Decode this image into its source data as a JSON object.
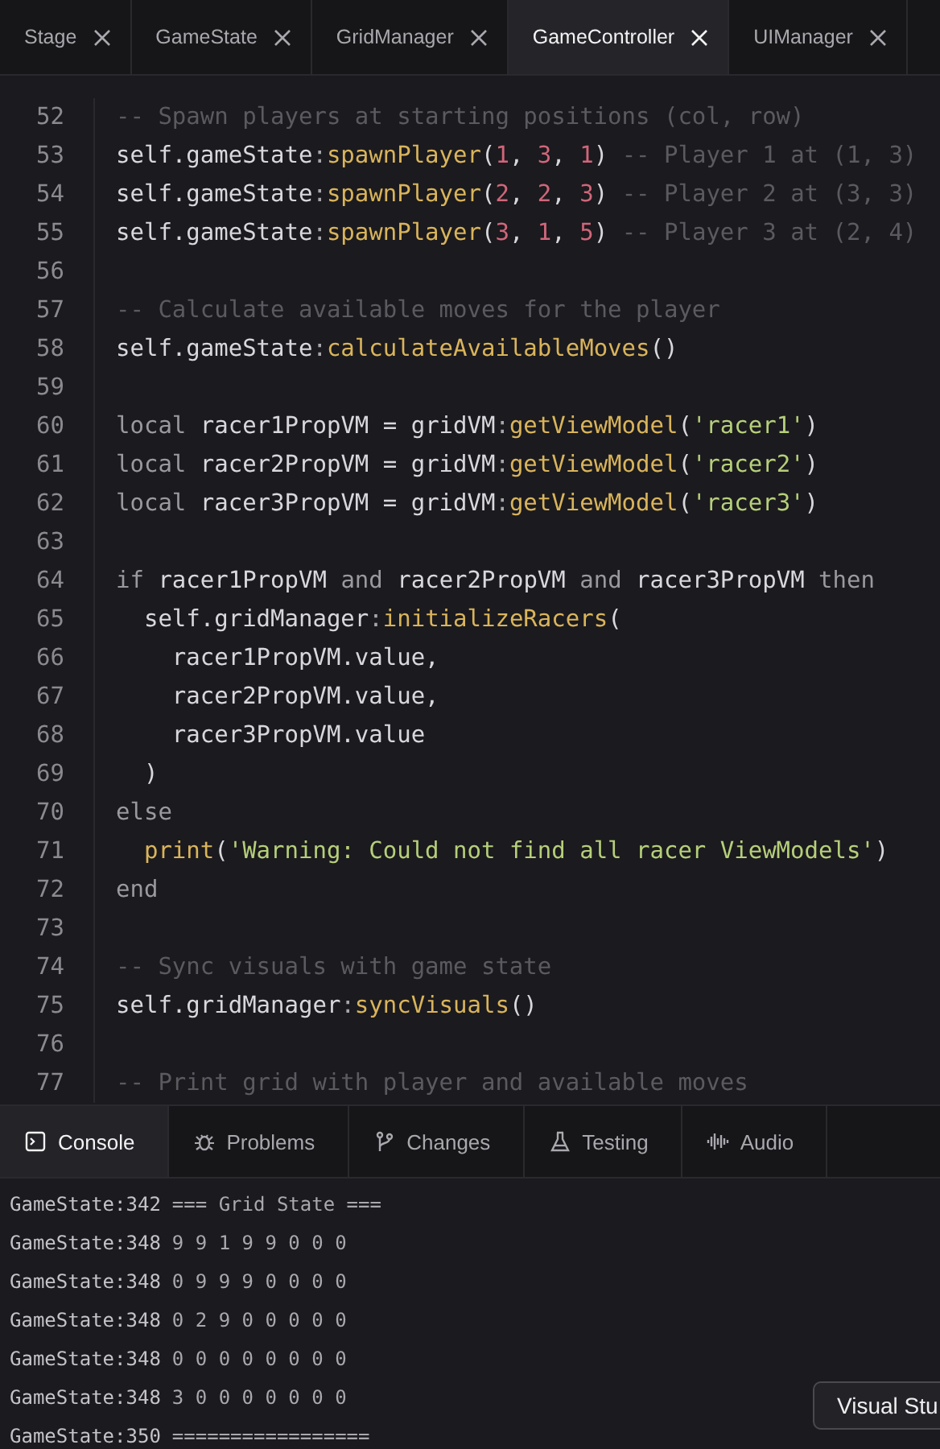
{
  "editor_tabs": [
    {
      "label": "Stage",
      "selected": false
    },
    {
      "label": "GameState",
      "selected": false
    },
    {
      "label": "GridManager",
      "selected": false
    },
    {
      "label": "GameController",
      "selected": true
    },
    {
      "label": "UIManager",
      "selected": false
    }
  ],
  "code_lines": [
    {
      "n": "52",
      "tokens": [
        {
          "text": "-- Spawn players at starting positions (col, row)",
          "kind": "comment"
        }
      ]
    },
    {
      "n": "53",
      "tokens": [
        {
          "text": "self.gameState",
          "kind": "plain"
        },
        {
          "text": ":",
          "kind": "punct"
        },
        {
          "text": "spawnPlayer",
          "kind": "fn"
        },
        {
          "text": "(",
          "kind": "plain"
        },
        {
          "text": "1",
          "kind": "num"
        },
        {
          "text": ", ",
          "kind": "plain"
        },
        {
          "text": "3",
          "kind": "num"
        },
        {
          "text": ", ",
          "kind": "plain"
        },
        {
          "text": "1",
          "kind": "num"
        },
        {
          "text": ")",
          "kind": "plain"
        },
        {
          "text": " -- Player 1 at (1, 3)",
          "kind": "comment"
        }
      ]
    },
    {
      "n": "54",
      "tokens": [
        {
          "text": "self.gameState",
          "kind": "plain"
        },
        {
          "text": ":",
          "kind": "punct"
        },
        {
          "text": "spawnPlayer",
          "kind": "fn"
        },
        {
          "text": "(",
          "kind": "plain"
        },
        {
          "text": "2",
          "kind": "num"
        },
        {
          "text": ", ",
          "kind": "plain"
        },
        {
          "text": "2",
          "kind": "num"
        },
        {
          "text": ", ",
          "kind": "plain"
        },
        {
          "text": "3",
          "kind": "num"
        },
        {
          "text": ")",
          "kind": "plain"
        },
        {
          "text": " -- Player 2 at (3, 3)",
          "kind": "comment"
        }
      ]
    },
    {
      "n": "55",
      "tokens": [
        {
          "text": "self.gameState",
          "kind": "plain"
        },
        {
          "text": ":",
          "kind": "punct"
        },
        {
          "text": "spawnPlayer",
          "kind": "fn"
        },
        {
          "text": "(",
          "kind": "plain"
        },
        {
          "text": "3",
          "kind": "num"
        },
        {
          "text": ", ",
          "kind": "plain"
        },
        {
          "text": "1",
          "kind": "num"
        },
        {
          "text": ", ",
          "kind": "plain"
        },
        {
          "text": "5",
          "kind": "num"
        },
        {
          "text": ")",
          "kind": "plain"
        },
        {
          "text": " -- Player 3 at (2, 4)",
          "kind": "comment"
        }
      ]
    },
    {
      "n": "56"
    },
    {
      "n": "57",
      "tokens": [
        {
          "text": "-- Calculate available moves for the player",
          "kind": "comment"
        }
      ]
    },
    {
      "n": "58",
      "tokens": [
        {
          "text": "self.gameState",
          "kind": "plain"
        },
        {
          "text": ":",
          "kind": "punct"
        },
        {
          "text": "calculateAvailableMoves",
          "kind": "fn"
        },
        {
          "text": "()",
          "kind": "plain"
        }
      ]
    },
    {
      "n": "59"
    },
    {
      "n": "60",
      "tokens": [
        {
          "text": "local ",
          "kind": "kw"
        },
        {
          "text": "racer1PropVM = gridVM",
          "kind": "plain"
        },
        {
          "text": ":",
          "kind": "punct"
        },
        {
          "text": "getViewModel",
          "kind": "fn"
        },
        {
          "text": "(",
          "kind": "plain"
        },
        {
          "text": "'racer1'",
          "kind": "str"
        },
        {
          "text": ")",
          "kind": "plain"
        }
      ]
    },
    {
      "n": "61",
      "tokens": [
        {
          "text": "local ",
          "kind": "kw"
        },
        {
          "text": "racer2PropVM = gridVM",
          "kind": "plain"
        },
        {
          "text": ":",
          "kind": "punct"
        },
        {
          "text": "getViewModel",
          "kind": "fn"
        },
        {
          "text": "(",
          "kind": "plain"
        },
        {
          "text": "'racer2'",
          "kind": "str"
        },
        {
          "text": ")",
          "kind": "plain"
        }
      ]
    },
    {
      "n": "62",
      "tokens": [
        {
          "text": "local ",
          "kind": "kw"
        },
        {
          "text": "racer3PropVM = gridVM",
          "kind": "plain"
        },
        {
          "text": ":",
          "kind": "punct"
        },
        {
          "text": "getViewModel",
          "kind": "fn"
        },
        {
          "text": "(",
          "kind": "plain"
        },
        {
          "text": "'racer3'",
          "kind": "str"
        },
        {
          "text": ")",
          "kind": "plain"
        }
      ]
    },
    {
      "n": "63"
    },
    {
      "n": "64",
      "tokens": [
        {
          "text": "if ",
          "kind": "kw"
        },
        {
          "text": "racer1PropVM ",
          "kind": "plain"
        },
        {
          "text": "and ",
          "kind": "kw"
        },
        {
          "text": "racer2PropVM ",
          "kind": "plain"
        },
        {
          "text": "and ",
          "kind": "kw"
        },
        {
          "text": "racer3PropVM ",
          "kind": "plain"
        },
        {
          "text": "then",
          "kind": "kw"
        }
      ]
    },
    {
      "n": "65",
      "tokens": [
        {
          "text": "  self.gridManager",
          "kind": "plain"
        },
        {
          "text": ":",
          "kind": "punct"
        },
        {
          "text": "initializeRacers",
          "kind": "fn"
        },
        {
          "text": "(",
          "kind": "plain"
        }
      ]
    },
    {
      "n": "66",
      "tokens": [
        {
          "text": "    racer1PropVM.value,",
          "kind": "plain"
        }
      ]
    },
    {
      "n": "67",
      "tokens": [
        {
          "text": "    racer2PropVM.value,",
          "kind": "plain"
        }
      ]
    },
    {
      "n": "68",
      "tokens": [
        {
          "text": "    racer3PropVM.value",
          "kind": "plain"
        }
      ]
    },
    {
      "n": "69",
      "tokens": [
        {
          "text": "  )",
          "kind": "plain"
        }
      ]
    },
    {
      "n": "70",
      "tokens": [
        {
          "text": "else",
          "kind": "kw"
        }
      ]
    },
    {
      "n": "71",
      "tokens": [
        {
          "text": "  print",
          "kind": "fn"
        },
        {
          "text": "(",
          "kind": "plain"
        },
        {
          "text": "'Warning: Could not find all racer ViewModels'",
          "kind": "str"
        },
        {
          "text": ")",
          "kind": "plain"
        }
      ]
    },
    {
      "n": "72",
      "tokens": [
        {
          "text": "end",
          "kind": "kw"
        }
      ]
    },
    {
      "n": "73"
    },
    {
      "n": "74",
      "tokens": [
        {
          "text": "-- Sync visuals with game state",
          "kind": "comment"
        }
      ]
    },
    {
      "n": "75",
      "tokens": [
        {
          "text": "self.gridManager",
          "kind": "plain"
        },
        {
          "text": ":",
          "kind": "punct"
        },
        {
          "text": "syncVisuals",
          "kind": "fn"
        },
        {
          "text": "()",
          "kind": "plain"
        }
      ]
    },
    {
      "n": "76"
    },
    {
      "n": "77",
      "tokens": [
        {
          "text": "-- Print grid with player and available moves",
          "kind": "comment"
        }
      ]
    }
  ],
  "panel_tabs": [
    {
      "label": "Console",
      "selected": true
    },
    {
      "label": "Problems",
      "selected": false
    },
    {
      "label": "Changes",
      "selected": false
    },
    {
      "label": "Testing",
      "selected": false
    },
    {
      "label": "Audio",
      "selected": false
    }
  ],
  "console_lines": [
    {
      "source": "GameState:342",
      "text": "=== Grid State ==="
    },
    {
      "source": "GameState:348",
      "text": "9 9 1 9 9 0 0 0"
    },
    {
      "source": "GameState:348",
      "text": "0 9 9 9 0 0 0 0"
    },
    {
      "source": "GameState:348",
      "text": "0 2 9 0 0 0 0 0"
    },
    {
      "source": "GameState:348",
      "text": "0 0 0 0 0 0 0 0"
    },
    {
      "source": "GameState:348",
      "text": "3 0 0 0 0 0 0 0"
    },
    {
      "source": "GameState:350",
      "text": "================="
    }
  ],
  "tooltip": {
    "text": "Visual Stu"
  }
}
